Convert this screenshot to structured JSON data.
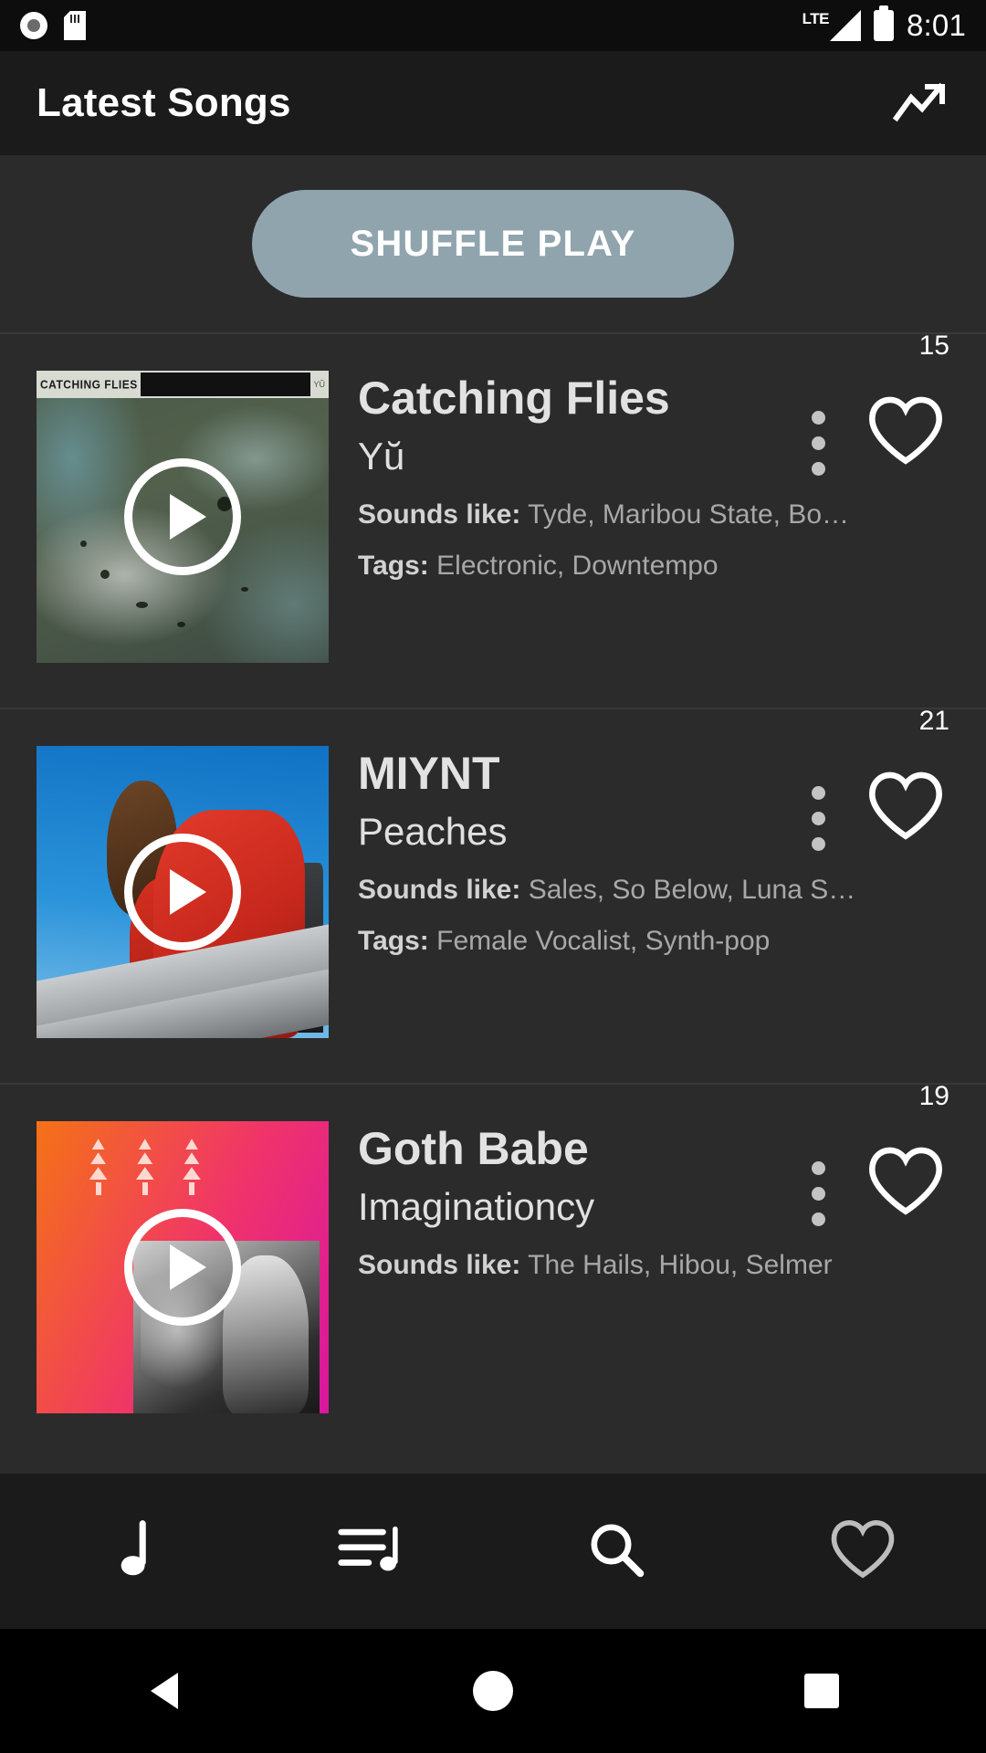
{
  "status_bar": {
    "time": "8:01",
    "network": "LTE",
    "icons": [
      "record-dot-icon",
      "sd-card-icon",
      "lte-signal-icon",
      "battery-icon"
    ]
  },
  "app_bar": {
    "title": "Latest Songs",
    "action_icon": "trending-up-icon"
  },
  "shuffle": {
    "label": "SHUFFLE PLAY",
    "color": "#90a4ae"
  },
  "labels": {
    "sounds_like": "Sounds like:",
    "tags": "Tags:"
  },
  "songs": [
    {
      "artist": "Catching Flies",
      "track": "Yŭ",
      "sounds_like": "Tyde, Maribou State, Bo…",
      "tags": "Electronic, Downtempo",
      "likes": "15",
      "art_label": "CATCHING FLIES"
    },
    {
      "artist": "MIYNT",
      "track": "Peaches",
      "sounds_like": "Sales, So Below, Luna S…",
      "tags": "Female Vocalist, Synth-pop",
      "likes": "21",
      "art_label": ""
    },
    {
      "artist": "Goth Babe",
      "track": "Imaginationcy",
      "sounds_like": "The Hails, Hibou, Selmer",
      "tags": "",
      "likes": "19",
      "art_label": ""
    }
  ],
  "bottom_nav": [
    {
      "name": "music-note-icon",
      "label": "Songs"
    },
    {
      "name": "playlist-icon",
      "label": "Playlists"
    },
    {
      "name": "search-icon",
      "label": "Search"
    },
    {
      "name": "heart-icon",
      "label": "Favorites"
    }
  ],
  "system_nav": [
    {
      "name": "back-button",
      "label": "Back"
    },
    {
      "name": "home-button",
      "label": "Home"
    },
    {
      "name": "recents-button",
      "label": "Recents"
    }
  ]
}
